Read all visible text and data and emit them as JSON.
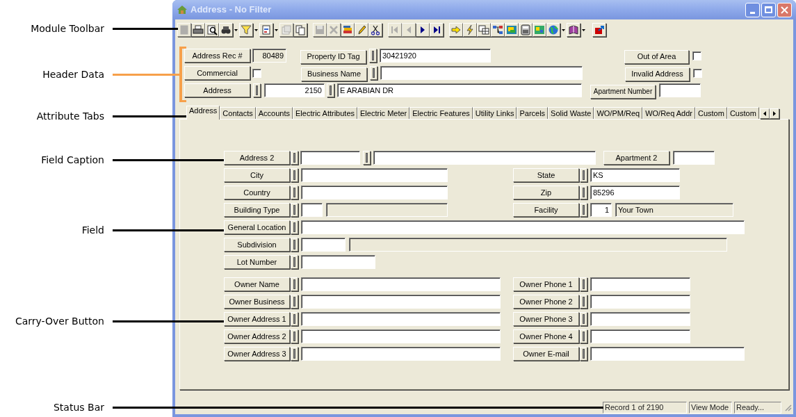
{
  "annotations": [
    {
      "label": "Module Toolbar",
      "kind": "line"
    },
    {
      "label": "Header Data",
      "kind": "bracket"
    },
    {
      "label": "Attribute Tabs",
      "kind": "line"
    },
    {
      "label": "Field Caption",
      "kind": "line"
    },
    {
      "label": "Field",
      "kind": "line"
    },
    {
      "label": "Carry-Over Button",
      "kind": "line"
    },
    {
      "label": "Status Bar",
      "kind": "line"
    }
  ],
  "window": {
    "title": "Address - No Filter"
  },
  "toolbar": [
    [
      {
        "kind": "doc",
        "disabled": true,
        "dropdown": false
      },
      {
        "kind": "printer",
        "disabled": false,
        "dropdown": false
      },
      {
        "kind": "preview",
        "disabled": false,
        "dropdown": false
      },
      {
        "kind": "binoculars",
        "disabled": false,
        "dropdown": true
      },
      {
        "kind": "filter",
        "disabled": false,
        "dropdown": true
      },
      {
        "kind": "report",
        "disabled": false,
        "dropdown": true
      },
      {
        "kind": "properties",
        "disabled": true,
        "dropdown": false
      },
      {
        "kind": "copy",
        "disabled": false,
        "dropdown": false
      }
    ],
    [
      {
        "kind": "save",
        "disabled": true,
        "dropdown": false
      },
      {
        "kind": "delete",
        "disabled": true,
        "dropdown": false
      },
      {
        "kind": "books",
        "disabled": false,
        "dropdown": false
      },
      {
        "kind": "pencil",
        "disabled": false,
        "dropdown": false
      },
      {
        "kind": "scissors",
        "disabled": false,
        "dropdown": false
      }
    ],
    [
      {
        "kind": "first",
        "disabled": true,
        "dropdown": false
      },
      {
        "kind": "prev",
        "disabled": true,
        "dropdown": false
      },
      {
        "kind": "next",
        "disabled": false,
        "dropdown": false
      },
      {
        "kind": "last",
        "disabled": false,
        "dropdown": false
      }
    ],
    [
      {
        "kind": "go",
        "disabled": false,
        "dropdown": false
      },
      {
        "kind": "lightning",
        "disabled": false,
        "dropdown": false
      },
      {
        "kind": "grid",
        "disabled": false,
        "dropdown": false
      },
      {
        "kind": "tree",
        "disabled": false,
        "dropdown": false
      },
      {
        "kind": "map",
        "disabled": false,
        "dropdown": false
      },
      {
        "kind": "calculator",
        "disabled": false,
        "dropdown": false
      },
      {
        "kind": "chart",
        "disabled": false,
        "dropdown": false
      },
      {
        "kind": "globe",
        "disabled": false,
        "dropdown": true
      },
      {
        "kind": "book",
        "disabled": false,
        "dropdown": true
      }
    ],
    [
      {
        "kind": "exit",
        "disabled": false,
        "dropdown": false
      }
    ]
  ],
  "header": {
    "record": {
      "caption": "Address Rec #",
      "value": "80489"
    },
    "property_id": {
      "caption": "Property ID Tag",
      "value": "30421920"
    },
    "out_of_area": {
      "caption": "Out of Area",
      "checked": false
    },
    "commercial": {
      "caption": "Commercial",
      "checked": false
    },
    "business_name": {
      "caption": "Business Name"
    },
    "invalid_address": {
      "caption": "Invalid Address",
      "checked": false
    },
    "address": {
      "caption": "Address",
      "number": "2150",
      "street": "E ARABIAN DR"
    },
    "apartment": {
      "caption": "Apartment Number"
    }
  },
  "tabs": [
    {
      "label": "Address",
      "selected": true
    },
    {
      "label": "Contacts",
      "selected": false
    },
    {
      "label": "Accounts",
      "selected": false
    },
    {
      "label": "Electric Attributes",
      "selected": false
    },
    {
      "label": "Electric Meter",
      "selected": false
    },
    {
      "label": "Electric Features",
      "selected": false
    },
    {
      "label": "Utility Links",
      "selected": false
    },
    {
      "label": "Parcels",
      "selected": false
    },
    {
      "label": "Solid Waste",
      "selected": false
    },
    {
      "label": "WO/PM/Req",
      "selected": false
    },
    {
      "label": "WO/Req Addr",
      "selected": false
    },
    {
      "label": "Custom",
      "selected": false
    },
    {
      "label": "Custom",
      "selected": false
    }
  ],
  "form_rows": [
    {
      "left": {
        "caption": "Address 2",
        "kind": "pair"
      },
      "right": {
        "caption": "Apartment 2",
        "kind": "plain"
      }
    },
    {
      "left": {
        "caption": "City",
        "kind": "text"
      },
      "right": {
        "caption": "State",
        "kind": "text",
        "value": "KS"
      }
    },
    {
      "left": {
        "caption": "Country",
        "kind": "text"
      },
      "right": {
        "caption": "Zip",
        "kind": "text",
        "value": "85296"
      }
    },
    {
      "left": {
        "caption": "Building Type",
        "kind": "lookup"
      },
      "right": {
        "caption": "Facility",
        "kind": "lookup",
        "code": "1",
        "description": "Your Town"
      }
    },
    {
      "left": {
        "caption": "General Location",
        "kind": "text"
      }
    },
    {
      "left": {
        "caption": "Subdivision",
        "kind": "lookup"
      }
    },
    {
      "left": {
        "caption": "Lot Number",
        "kind": "text"
      }
    },
    {
      "left": {
        "caption": "Owner Name",
        "kind": "text"
      },
      "right": {
        "caption": "Owner Phone 1",
        "kind": "text"
      }
    },
    {
      "left": {
        "caption": "Owner Business",
        "kind": "text"
      },
      "right": {
        "caption": "Owner Phone 2",
        "kind": "text"
      }
    },
    {
      "left": {
        "caption": "Owner Address 1",
        "kind": "text"
      },
      "right": {
        "caption": "Owner Phone 3",
        "kind": "text"
      }
    },
    {
      "left": {
        "caption": "Owner Address 2",
        "kind": "text"
      },
      "right": {
        "caption": "Owner Phone 4",
        "kind": "text"
      }
    },
    {
      "left": {
        "caption": "Owner Address 3",
        "kind": "text"
      },
      "right": {
        "caption": "Owner E-mail",
        "kind": "text"
      }
    }
  ],
  "status_bar": {
    "record": "Record 1 of 2190",
    "mode": "View Mode",
    "state": "Ready..."
  }
}
